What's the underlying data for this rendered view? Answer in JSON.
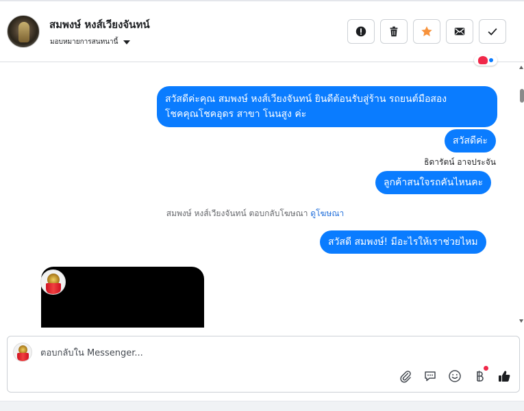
{
  "header": {
    "contact_name": "สมพงษ์ หงส์เวียงจันทน์",
    "assign_label": "มอบหมายการสนทนานี้",
    "buttons": [
      {
        "name": "spam",
        "icon": "exclamation-circle-icon"
      },
      {
        "name": "delete",
        "icon": "trash-icon"
      },
      {
        "name": "star",
        "icon": "star-icon",
        "color": "#f7923b"
      },
      {
        "name": "mark-unread",
        "icon": "envelope-icon"
      },
      {
        "name": "done",
        "icon": "check-icon"
      }
    ]
  },
  "messages": [
    {
      "line1": "สวัสดีค่ะคุณ สมพงษ์ หงส์เวียงจันทน์ ยินดีต้อนรับสู่ร้าน รถยนต์มือสอง",
      "line2": "โชคคุณโชคอุดร สาขา โนนสูง ค่ะ"
    },
    {
      "text": "สวัสดีค่ะ"
    },
    {
      "text": "ลูกค้าสนใจรถคันไหนคะ"
    },
    {
      "text": "สวัสดี สมพงษ์! มีอะไรให้เราช่วยไหม"
    }
  ],
  "sender_label": "ธิดารัตน์ อาจประจัน",
  "system_note": {
    "text": "สมพงษ์ หงส์เวียงจันทน์ ตอบกลับโฆษณา",
    "link": "ดูโฆษณา"
  },
  "composer": {
    "placeholder": "ตอบกลับใน Messenger...",
    "tools": [
      "paperclip-icon",
      "saved-reply-icon",
      "emoji-icon",
      "baht-payment-icon",
      "thumbs-up-icon"
    ]
  },
  "colors": {
    "bubble": "#0a7cff",
    "accent_star": "#f7923b",
    "link": "#216fdb",
    "notification": "#f02849"
  }
}
